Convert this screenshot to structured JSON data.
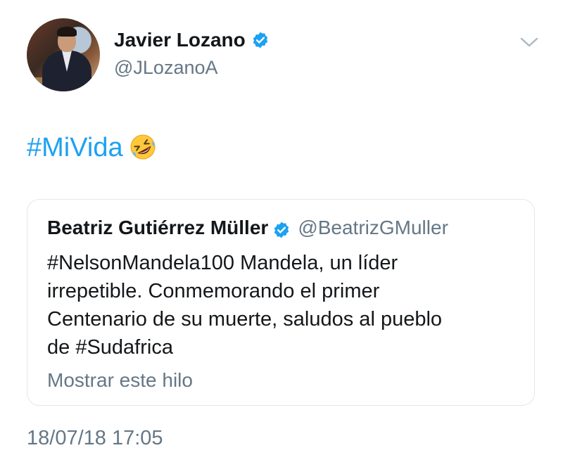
{
  "author": {
    "name": "Javier Lozano",
    "handle": "@JLozanoA",
    "verified": true
  },
  "tweet": {
    "hashtag": "#MiVida",
    "emoji": "rolling-on-the-floor-laughing-emoji"
  },
  "quoted_tweet": {
    "name": "Beatriz Gutiérrez Müller",
    "handle": "@BeatrizGMuller",
    "verified": true,
    "text_lines": [
      "#NelsonMandela100 Mandela, un líder",
      "irrepetible. Conmemorando el primer",
      "Centenario de su muerte, saludos al pueblo",
      "de #Sudafrica"
    ],
    "show_thread_label": "Mostrar este hilo"
  },
  "timestamp": "18/07/18 17:05",
  "colors": {
    "link": "#1da1f2",
    "verified": "#1da1f2",
    "secondary_text": "#657786",
    "primary_text": "#14171a",
    "border": "#e1e8ed",
    "chevron": "#aab8c2"
  },
  "icons": {
    "verified": "verified-badge-icon",
    "menu": "chevron-down-icon"
  }
}
